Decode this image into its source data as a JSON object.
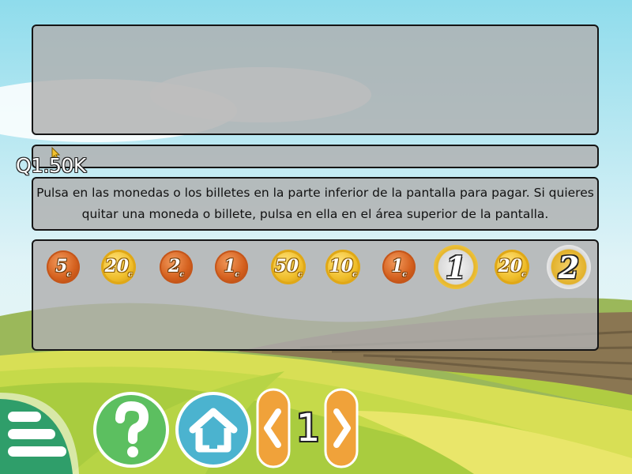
{
  "price_label": "Q1.50K",
  "instructions": "Pulsa en las monedas o los billetes en la parte inferior de la pantalla para pagar. Si quieres quitar una moneda o billete, pulsa en ella en el área superior de la pantalla.",
  "coins": [
    {
      "value": "5",
      "unit": "c",
      "metal": "copper"
    },
    {
      "value": "20",
      "unit": "c",
      "metal": "gold"
    },
    {
      "value": "2",
      "unit": "c",
      "metal": "copper"
    },
    {
      "value": "1",
      "unit": "c",
      "metal": "copper"
    },
    {
      "value": "50",
      "unit": "c",
      "metal": "gold"
    },
    {
      "value": "10",
      "unit": "c",
      "metal": "gold"
    },
    {
      "value": "1",
      "unit": "c",
      "metal": "copper"
    },
    {
      "value": "1",
      "unit": "",
      "metal": "euro1"
    },
    {
      "value": "20",
      "unit": "c",
      "metal": "gold"
    },
    {
      "value": "2",
      "unit": "",
      "metal": "euro2"
    }
  ],
  "pager": {
    "current": "1"
  },
  "icons": {
    "menu": "menu-icon",
    "help": "question-mark-icon",
    "home": "home-icon",
    "prev": "chevron-left-icon",
    "next": "chevron-right-icon",
    "cursor": "pointer-cursor-icon"
  },
  "colors": {
    "help_button": "#5cbf60",
    "home_button": "#4bb3cf",
    "pager_button": "#f0a23a",
    "panel": "#b0b0b0"
  }
}
